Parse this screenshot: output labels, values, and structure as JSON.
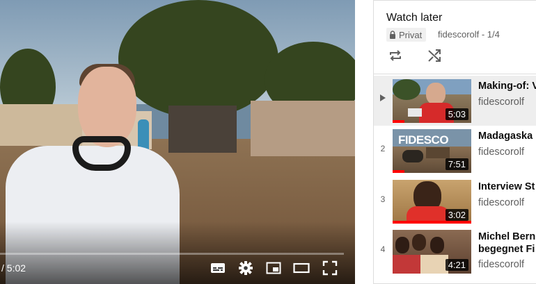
{
  "player": {
    "time_display": "/ 5:02",
    "controls": [
      "subtitles-icon",
      "settings-icon",
      "miniplayer-icon",
      "theater-mode-icon",
      "fullscreen-icon"
    ]
  },
  "playlist": {
    "title": "Watch later",
    "privacy": "Privat",
    "owner_position": "fidescorolf - 1/4",
    "items": [
      {
        "index": "",
        "playing": true,
        "title": "Making-of: V",
        "channel": "fidescorolf",
        "duration": "5:03",
        "watched_fraction": 0.15
      },
      {
        "index": "2",
        "playing": false,
        "title": "Madagaska",
        "channel": "fidescorolf",
        "duration": "7:51",
        "watched_fraction": 0.15
      },
      {
        "index": "3",
        "playing": false,
        "title": "Interview St",
        "channel": "fidescorolf",
        "duration": "3:02",
        "watched_fraction": 1.0
      },
      {
        "index": "4",
        "playing": false,
        "title_lines": [
          "Michel Bern",
          "begegnet Fi"
        ],
        "channel": "fidescorolf",
        "duration": "4:21",
        "watched_fraction": 0.0
      }
    ]
  },
  "colors": {
    "accent": "#ff0000",
    "active_row": "#eeeeee",
    "muted_text": "#606060"
  }
}
